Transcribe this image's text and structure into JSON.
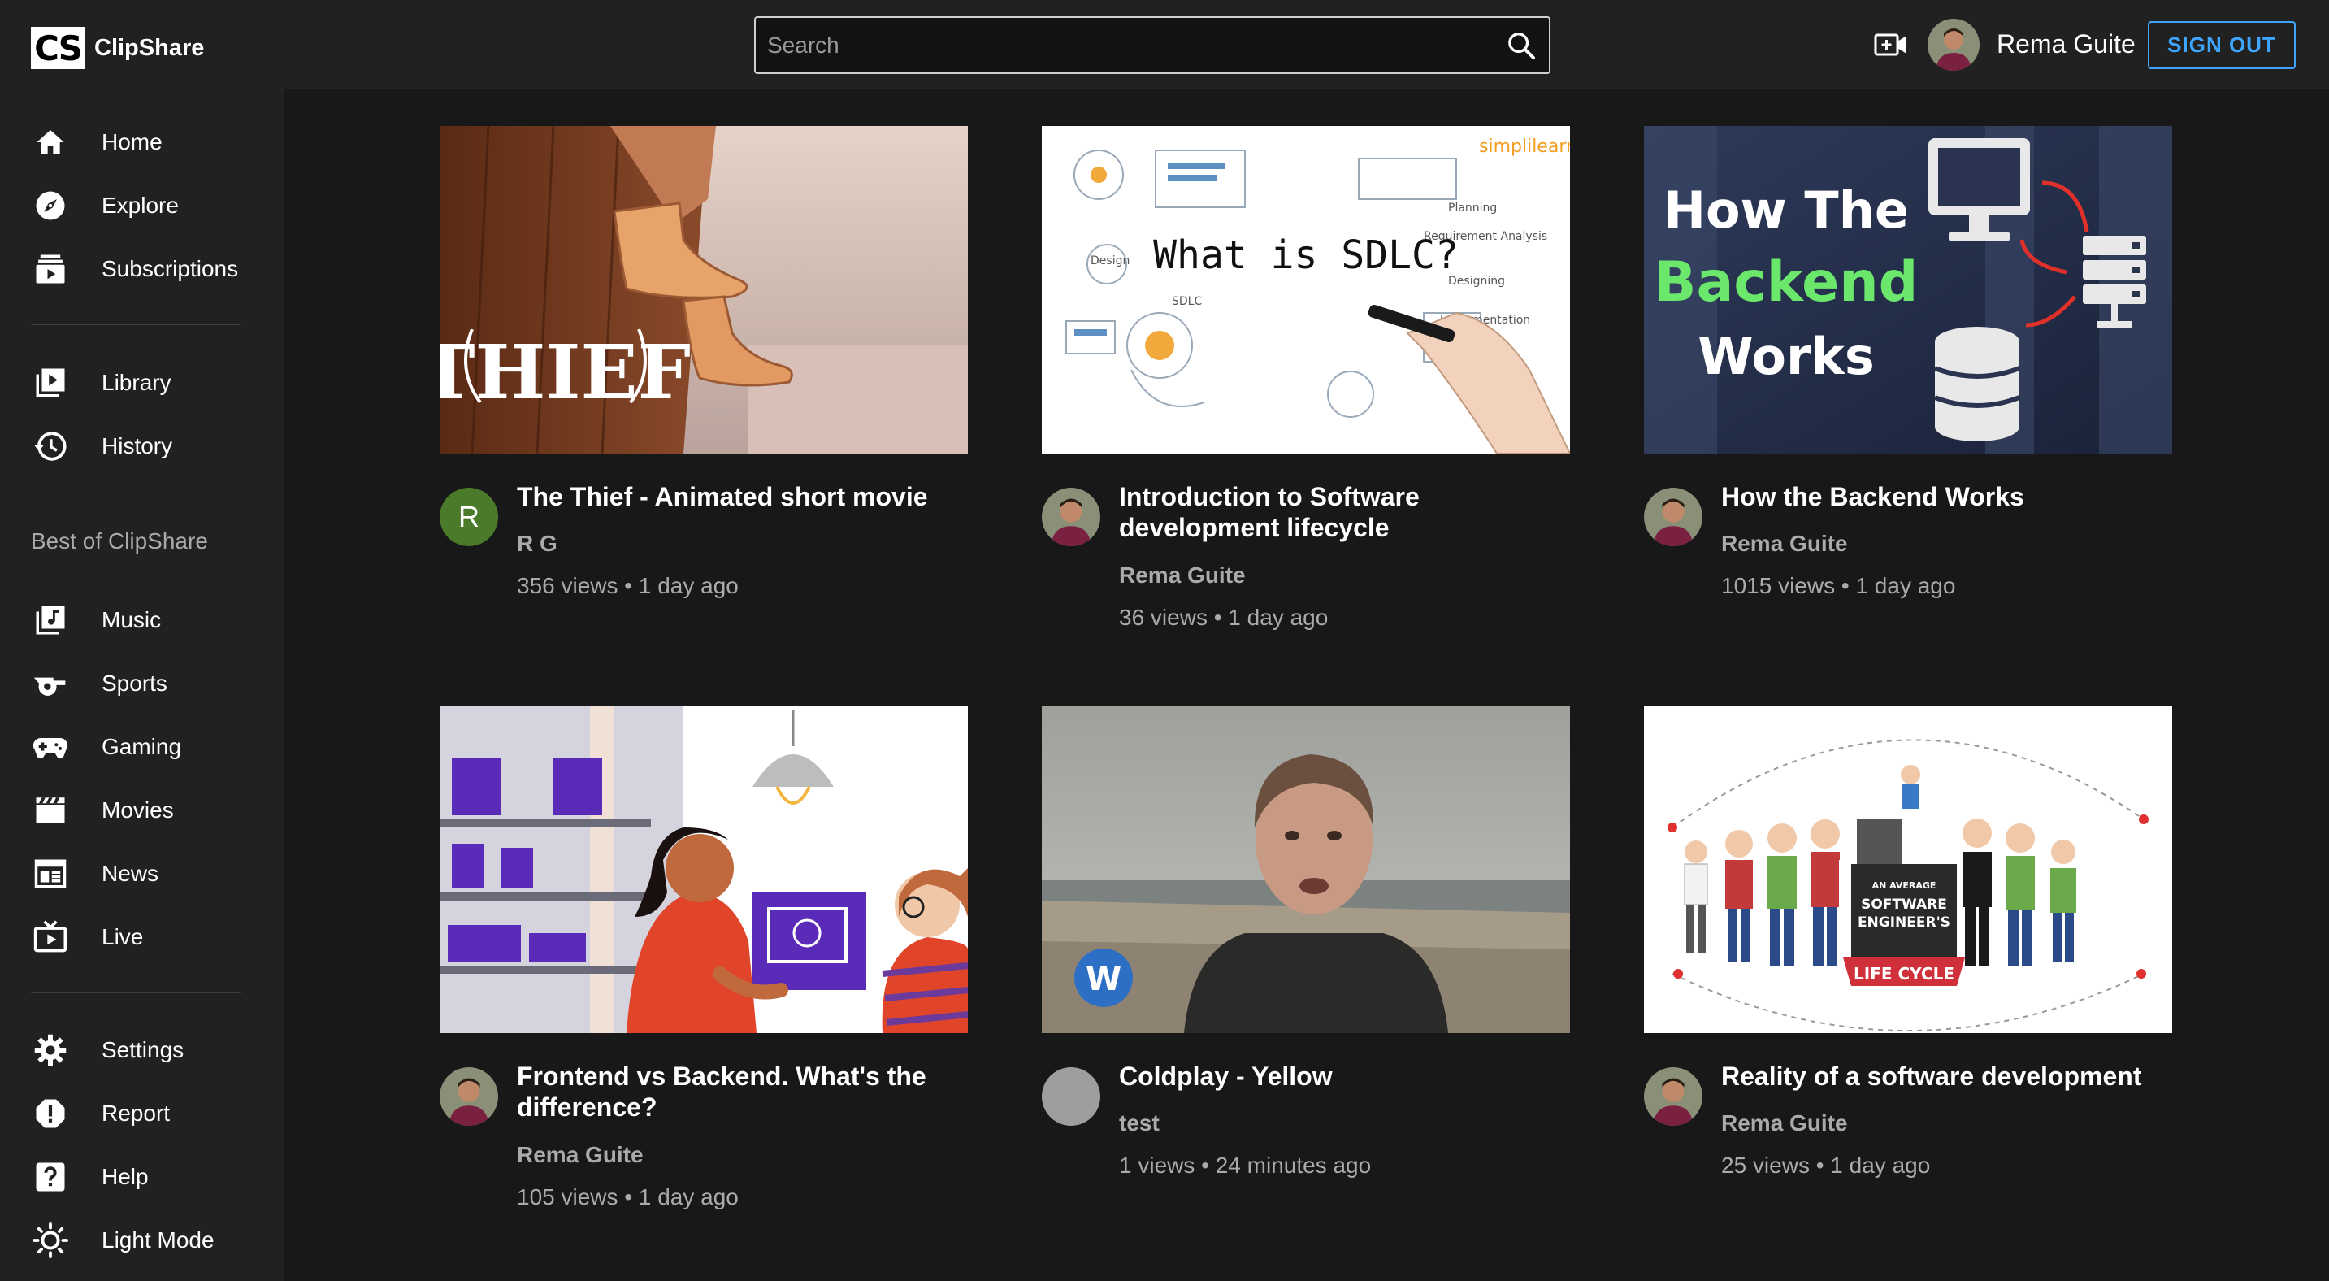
{
  "brand": {
    "mark": "CS",
    "name": "ClipShare"
  },
  "search": {
    "placeholder": "Search",
    "value": ""
  },
  "user": {
    "name": "Rema Guite",
    "sign_out": "SIGN OUT"
  },
  "colors": {
    "accent": "#3ea6ff",
    "background": "#181818",
    "surface": "#212121"
  },
  "sidebar": {
    "main": [
      {
        "label": "Home",
        "icon": "home-icon"
      },
      {
        "label": "Explore",
        "icon": "compass-icon"
      },
      {
        "label": "Subscriptions",
        "icon": "subscriptions-icon"
      }
    ],
    "library": [
      {
        "label": "Library",
        "icon": "library-icon"
      },
      {
        "label": "History",
        "icon": "history-icon"
      }
    ],
    "best_title": "Best of ClipShare",
    "best": [
      {
        "label": "Music",
        "icon": "music-icon"
      },
      {
        "label": "Sports",
        "icon": "whistle-icon"
      },
      {
        "label": "Gaming",
        "icon": "gamepad-icon"
      },
      {
        "label": "Movies",
        "icon": "clapperboard-icon"
      },
      {
        "label": "News",
        "icon": "newspaper-icon"
      },
      {
        "label": "Live",
        "icon": "live-tv-icon"
      }
    ],
    "settings": [
      {
        "label": "Settings",
        "icon": "gear-icon"
      },
      {
        "label": "Report",
        "icon": "report-icon"
      },
      {
        "label": "Help",
        "icon": "help-icon"
      },
      {
        "label": "Light Mode",
        "icon": "sun-icon"
      }
    ]
  },
  "videos": [
    {
      "title": "The Thief - Animated short movie",
      "channel": "R G",
      "meta": "356 views • 1 day ago",
      "avatar_letter": "R",
      "thumb_text": "THIEF"
    },
    {
      "title": "Introduction to Software development lifecycle",
      "channel": "Rema Guite",
      "meta": "36 views • 1 day ago",
      "thumb_text": "What is SDLC?",
      "thumb_brand": "simplilearn"
    },
    {
      "title": "How the Backend Works",
      "channel": "Rema Guite",
      "meta": "1015 views • 1 day ago",
      "thumb_text_1": "How The",
      "thumb_text_2": "Backend",
      "thumb_text_3": "Works"
    },
    {
      "title": "Frontend vs Backend. What's the difference?",
      "channel": "Rema Guite",
      "meta": "105 views • 1 day ago"
    },
    {
      "title": "Coldplay - Yellow",
      "channel": "test",
      "meta": "1 views • 24 minutes ago"
    },
    {
      "title": "Reality of a software development",
      "channel": "Rema Guite",
      "meta": "25 views • 1 day ago",
      "thumb_text_1": "AN AVERAGE",
      "thumb_text_2": "SOFTWARE",
      "thumb_text_3": "ENGINEER'S",
      "thumb_text_4": "LIFE CYCLE"
    }
  ]
}
